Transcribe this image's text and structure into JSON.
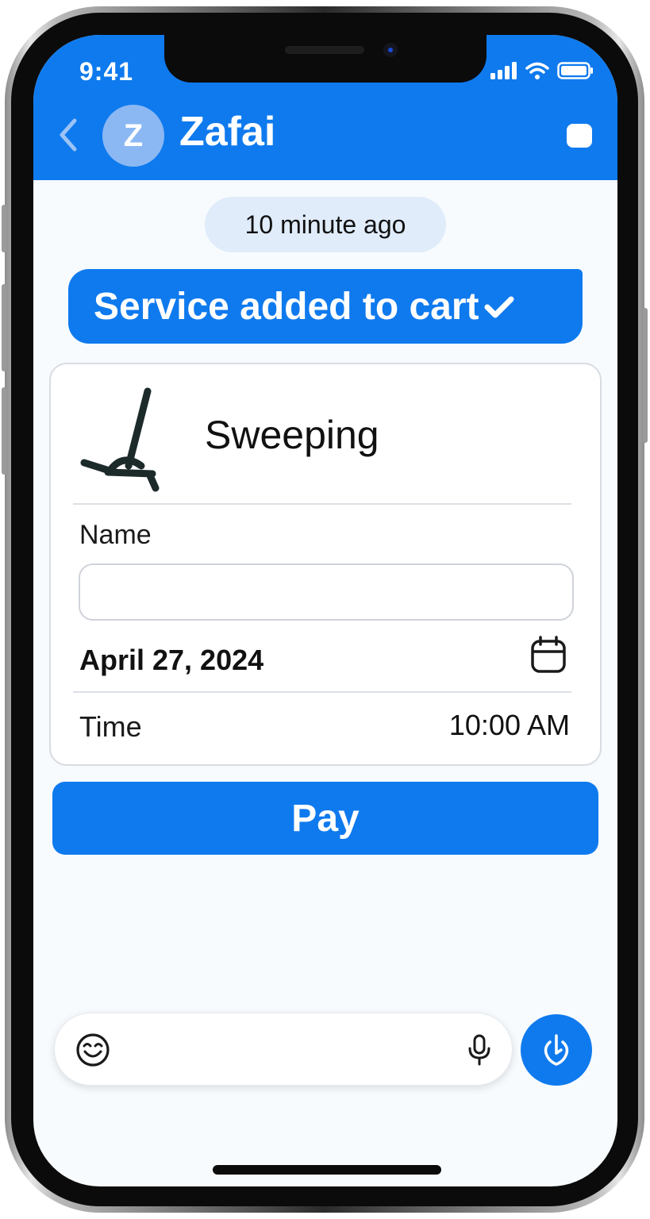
{
  "status_bar": {
    "time": "9:41"
  },
  "header": {
    "avatar_letter": "Z",
    "title": "Zafai",
    "back_icon": "chevron-left-icon",
    "menu_icon": "square-menu-icon"
  },
  "chat": {
    "timestamp": "10 minute ago",
    "bubble_text": "Service added to cart"
  },
  "service_card": {
    "title": "Sweeping",
    "icon": "broom-icon",
    "name_label": "Name",
    "name_value": "",
    "date": "April 27, 2024",
    "time_label": "Time",
    "time_value": "10:00 AM"
  },
  "actions": {
    "pay_label": "Pay"
  },
  "composer": {
    "placeholder": "",
    "emoji_icon": "smiley-icon",
    "mic_icon": "microphone-icon",
    "send_icon": "send-icon"
  },
  "colors": {
    "accent": "#0f7aee",
    "background": "#f7fbfe",
    "avatar": "#8bb8f3",
    "timestamp_pill": "#e0ecfa"
  }
}
